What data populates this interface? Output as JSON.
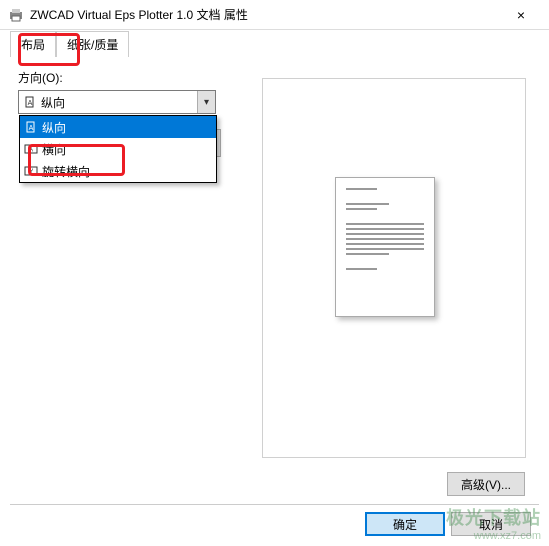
{
  "titlebar": {
    "title": "ZWCAD Virtual Eps Plotter 1.0 文档 属性",
    "close": "×"
  },
  "tabs": {
    "layout": "布局",
    "paper": "纸张/质量"
  },
  "orient": {
    "label": "方向(O):",
    "selected": "纵向",
    "options": {
      "portrait": "纵向",
      "landscape": "横向",
      "rotated": "旋转横向"
    }
  },
  "buttons": {
    "advanced": "高级(V)...",
    "ok": "确定",
    "cancel": "取消"
  },
  "watermark": {
    "name": "极光下载站",
    "url": "www.xz7.com"
  }
}
